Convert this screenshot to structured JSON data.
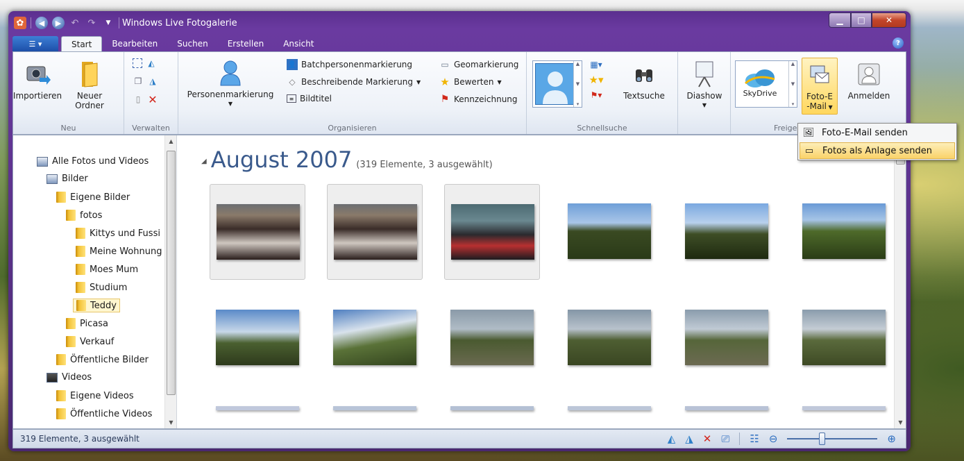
{
  "window": {
    "title": "Windows Live Fotogalerie"
  },
  "tabs": [
    "Start",
    "Bearbeiten",
    "Suchen",
    "Erstellen",
    "Ansicht"
  ],
  "active_tab": "Start",
  "ribbon": {
    "neu": {
      "label": "Neu",
      "import": "Importieren",
      "new_folder": "Neuer Ordner"
    },
    "verwalten": {
      "label": "Verwalten"
    },
    "organisieren": {
      "label": "Organisieren",
      "person_tag": "Personenmarkierung",
      "batch": "Batchpersonenmarkierung",
      "desc_tag": "Beschreibende Markierung",
      "caption": "Bildtitel",
      "geo": "Geomarkierung",
      "rate": "Bewerten",
      "flag": "Kennzeichnung"
    },
    "schnellsuche": {
      "label": "Schnellsuche",
      "textsuche": "Textsuche"
    },
    "diashow": "Diashow",
    "freigeben": {
      "label": "Freigeben",
      "skydrive": "SkyDrive",
      "foto_email_line1": "Foto-E",
      "foto_email_line2": "-Mail",
      "anmelden": "Anmelden"
    }
  },
  "dropdown": {
    "item1": "Foto-E-Mail senden",
    "item2": "Fotos als Anlage senden"
  },
  "sidebar": {
    "items": [
      "Alle Fotos und Videos",
      "Bilder",
      "Eigene Bilder",
      "fotos",
      "Kittys und Fussi",
      "Meine Wohnung",
      "Moes Mum",
      "Studium",
      "Teddy",
      "Picasa",
      "Verkauf",
      "Öffentliche Bilder",
      "Videos",
      "Eigene Videos",
      "Öffentliche Videos"
    ],
    "selected": "Teddy"
  },
  "gallery": {
    "heading": "August 2007",
    "subheading": "(319 Elemente, 3 ausgewählt)"
  },
  "status": {
    "text": "319 Elemente, 3 ausgewählt",
    "zoom_fraction": 0.38
  }
}
